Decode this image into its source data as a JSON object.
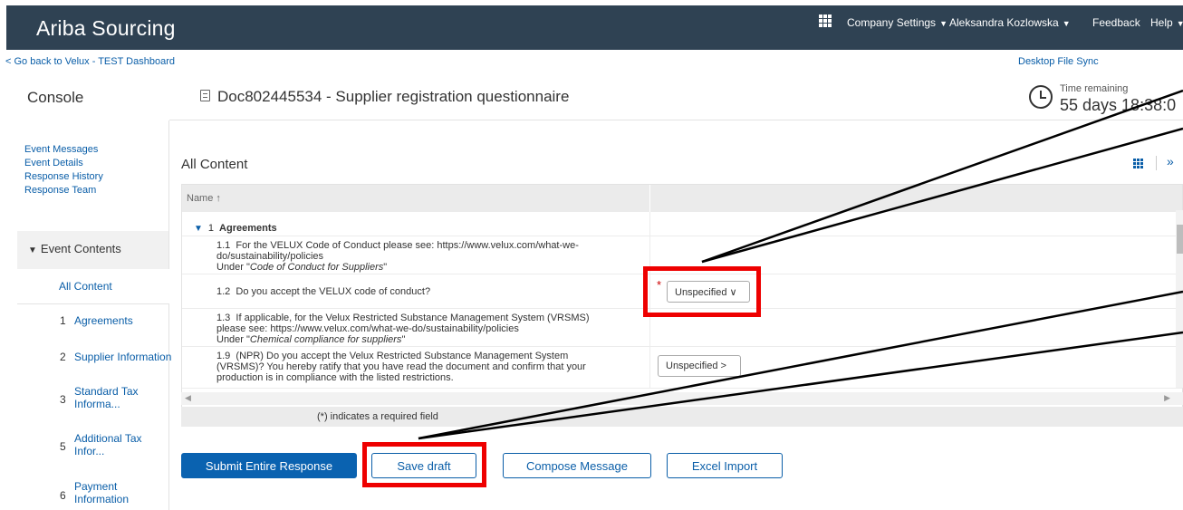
{
  "header": {
    "brand": "Ariba Sourcing",
    "company_settings": "Company Settings",
    "user": "Aleksandra Kozlowska",
    "feedback": "Feedback",
    "help": "Help"
  },
  "subbar": {
    "back_link": "< Go back to Velux - TEST Dashboard",
    "desktop_sync": "Desktop File Sync"
  },
  "page": {
    "console_title": "Console",
    "doc_title": "Doc802445534 - Supplier registration questionnaire",
    "time_label": "Time remaining",
    "time_value": "55 days 18:38:0"
  },
  "sidebar": {
    "links": [
      "Event Messages",
      "Event Details",
      "Response History",
      "Response Team"
    ],
    "section_label": "Event Contents",
    "items": [
      {
        "num": "",
        "label": "All Content"
      },
      {
        "num": "1",
        "label": "Agreements"
      },
      {
        "num": "2",
        "label": "Supplier Information"
      },
      {
        "num": "3",
        "label": "Standard Tax Informa..."
      },
      {
        "num": "5",
        "label": "Additional Tax Infor..."
      },
      {
        "num": "6",
        "label": "Payment Information"
      }
    ]
  },
  "content": {
    "heading": "All Content",
    "col_name": "Name ↑",
    "section": {
      "num": "1",
      "label": "Agreements"
    },
    "rows": [
      {
        "num": "1.1",
        "line1": "For the VELUX Code of Conduct please see: https://www.velux.com/what-we-",
        "line2": "do/sustainability/policies",
        "line3a": "Under \"",
        "line3b": "Code of Conduct for Suppliers",
        "line3c": "\""
      },
      {
        "num": "1.2",
        "line1": "Do you accept the VELUX code of conduct?",
        "select": "Unspecified",
        "required": "*"
      },
      {
        "num": "1.3",
        "line1": "If applicable, for the Velux Restricted Substance Management System (VRSMS)",
        "line2": "please see: https://www.velux.com/what-we-do/sustainability/policies",
        "line3a": "Under \"",
        "line3b": "Chemical compliance for suppliers",
        "line3c": "\""
      },
      {
        "num": "1.9",
        "line1": "(NPR) Do you accept the Velux Restricted Substance Management System",
        "line2": "(VRSMS)? You hereby ratify that you have read the document and confirm that your",
        "line3a": "production is in compliance with the listed restrictions.",
        "select": "Unspecified"
      }
    ],
    "footnote": "(*) indicates a required field"
  },
  "actions": {
    "submit": "Submit Entire Response",
    "save_draft": "Save draft",
    "compose": "Compose Message",
    "excel": "Excel Import"
  },
  "colors": {
    "topbar": "#2f4253",
    "accent": "#0a62b0",
    "highlight": "#ee0000"
  }
}
